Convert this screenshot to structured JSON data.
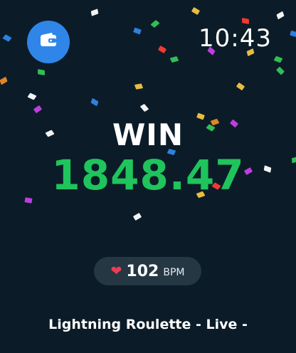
{
  "status": {
    "time": "10:43"
  },
  "wallet": {
    "icon": "wallet-icon",
    "color": "#2f86e8"
  },
  "result": {
    "label": "WIN",
    "amount": "1848.47",
    "amount_color": "#1fc45c"
  },
  "heart_rate": {
    "icon": "heart-icon",
    "value": "102",
    "unit": "BPM"
  },
  "game": {
    "title": "Lightning Roulette - Live -"
  },
  "confetti_colors": [
    "#ffffff",
    "#f4c542",
    "#34c759",
    "#2f86e8",
    "#ff3b30",
    "#c740e8",
    "#f08a24"
  ]
}
